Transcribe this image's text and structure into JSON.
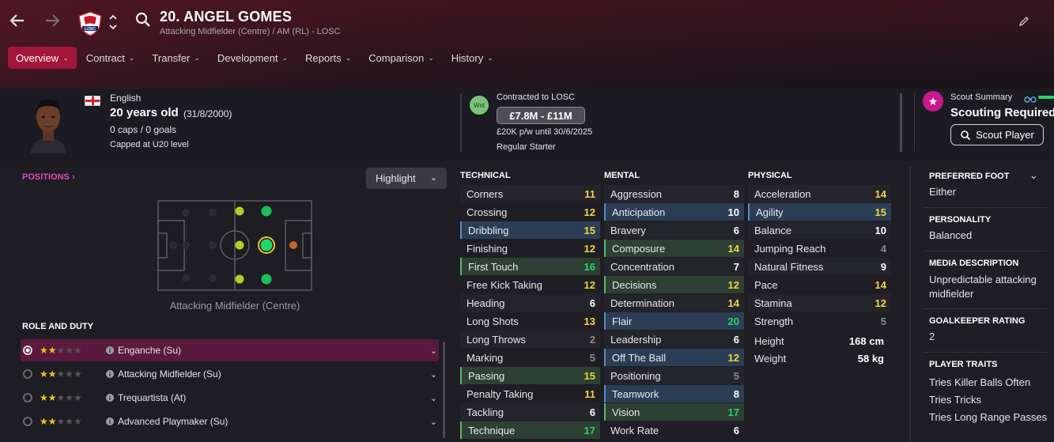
{
  "player": {
    "name": "20. ANGEL GOMES",
    "subtitle": "Attacking Midfielder (Centre) / AM (RL) - LOSC",
    "club_badge_text": "LOSC"
  },
  "tabs": [
    {
      "label": "Overview",
      "active": true
    },
    {
      "label": "Contract"
    },
    {
      "label": "Transfer"
    },
    {
      "label": "Development"
    },
    {
      "label": "Reports"
    },
    {
      "label": "Comparison"
    },
    {
      "label": "History"
    }
  ],
  "bio": {
    "nationality": "English",
    "age": "20 years old",
    "dob": "(31/8/2000)",
    "caps": "0 caps / 0 goals",
    "capped_level": "Capped at U20 level"
  },
  "contract": {
    "badge": "Wnt",
    "title": "Contracted to LOSC",
    "value": "£7.8M - £11M",
    "wage": "£20K p/w until 30/6/2025",
    "status": "Regular Starter"
  },
  "scout": {
    "title": "Scout Summary",
    "status": "Scouting Required",
    "button": "Scout Player"
  },
  "positions": {
    "title": "POSITIONS",
    "highlight": "Highlight",
    "caption": "Attacking Midfielder (Centre)"
  },
  "roles": {
    "title": "ROLE AND DUTY",
    "items": [
      {
        "name": "Enganche (Su)",
        "stars": 2,
        "selected": true
      },
      {
        "name": "Attacking Midfielder (Su)",
        "stars": 2
      },
      {
        "name": "Trequartista (At)",
        "stars": 2
      },
      {
        "name": "Advanced Playmaker (Su)",
        "stars": 2
      }
    ]
  },
  "technical": {
    "title": "TECHNICAL",
    "items": [
      {
        "name": "Corners",
        "value": "11",
        "hl": ""
      },
      {
        "name": "Crossing",
        "value": "12",
        "hl": ""
      },
      {
        "name": "Dribbling",
        "value": "15",
        "hl": "blue"
      },
      {
        "name": "Finishing",
        "value": "12",
        "hl": ""
      },
      {
        "name": "First Touch",
        "value": "16",
        "hl": "green"
      },
      {
        "name": "Free Kick Taking",
        "value": "12",
        "hl": ""
      },
      {
        "name": "Heading",
        "value": "6",
        "hl": ""
      },
      {
        "name": "Long Shots",
        "value": "13",
        "hl": ""
      },
      {
        "name": "Long Throws",
        "value": "2",
        "hl": ""
      },
      {
        "name": "Marking",
        "value": "5",
        "hl": ""
      },
      {
        "name": "Passing",
        "value": "15",
        "hl": "green"
      },
      {
        "name": "Penalty Taking",
        "value": "11",
        "hl": ""
      },
      {
        "name": "Tackling",
        "value": "6",
        "hl": ""
      },
      {
        "name": "Technique",
        "value": "17",
        "hl": "green"
      }
    ]
  },
  "mental": {
    "title": "MENTAL",
    "items": [
      {
        "name": "Aggression",
        "value": "8",
        "hl": ""
      },
      {
        "name": "Anticipation",
        "value": "10",
        "hl": "blue"
      },
      {
        "name": "Bravery",
        "value": "6",
        "hl": ""
      },
      {
        "name": "Composure",
        "value": "14",
        "hl": "green"
      },
      {
        "name": "Concentration",
        "value": "7",
        "hl": ""
      },
      {
        "name": "Decisions",
        "value": "12",
        "hl": "green"
      },
      {
        "name": "Determination",
        "value": "14",
        "hl": ""
      },
      {
        "name": "Flair",
        "value": "20",
        "hl": "blue"
      },
      {
        "name": "Leadership",
        "value": "6",
        "hl": ""
      },
      {
        "name": "Off The Ball",
        "value": "12",
        "hl": "blue"
      },
      {
        "name": "Positioning",
        "value": "5",
        "hl": ""
      },
      {
        "name": "Teamwork",
        "value": "8",
        "hl": "blue"
      },
      {
        "name": "Vision",
        "value": "17",
        "hl": "green"
      },
      {
        "name": "Work Rate",
        "value": "6",
        "hl": ""
      }
    ]
  },
  "physical": {
    "title": "PHYSICAL",
    "items": [
      {
        "name": "Acceleration",
        "value": "14",
        "hl": ""
      },
      {
        "name": "Agility",
        "value": "15",
        "hl": "blue"
      },
      {
        "name": "Balance",
        "value": "10",
        "hl": ""
      },
      {
        "name": "Jumping Reach",
        "value": "4",
        "hl": ""
      },
      {
        "name": "Natural Fitness",
        "value": "9",
        "hl": ""
      },
      {
        "name": "Pace",
        "value": "14",
        "hl": ""
      },
      {
        "name": "Stamina",
        "value": "12",
        "hl": ""
      },
      {
        "name": "Strength",
        "value": "5",
        "hl": ""
      }
    ],
    "height_label": "Height",
    "height": "168 cm",
    "weight_label": "Weight",
    "weight": "58 kg"
  },
  "side": {
    "foot_title": "PREFERRED FOOT",
    "foot": "Either",
    "personality_title": "PERSONALITY",
    "personality": "Balanced",
    "media_title": "MEDIA DESCRIPTION",
    "media": "Unpredictable attacking midfielder",
    "gk_title": "GOALKEEPER RATING",
    "gk": "2",
    "traits_title": "PLAYER TRAITS",
    "traits": [
      "Tries Killer Balls Often",
      "Tries Tricks",
      "Tries Long Range Passes"
    ]
  }
}
